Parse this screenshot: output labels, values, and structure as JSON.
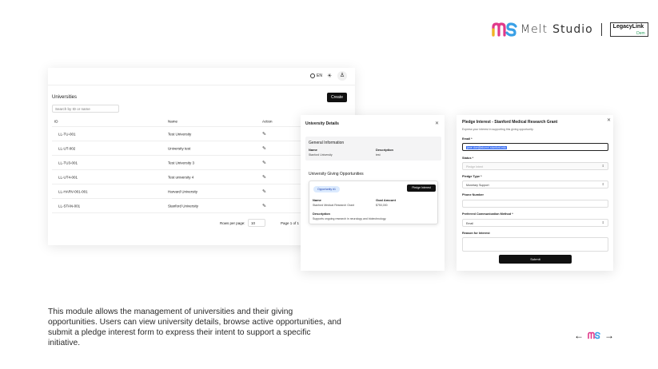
{
  "brand": {
    "melt": "Melt",
    "studio": "Studio",
    "partner_line1": "LegacyLink",
    "partner_line2": "Dem"
  },
  "panel_universities": {
    "lang": "EN",
    "title": "Universities",
    "create_label": "Create",
    "search_placeholder": "Search by ID or name",
    "columns": [
      "ID",
      "Name",
      "Action"
    ],
    "rows": [
      {
        "id": "LL-TU-001",
        "name": "Test University"
      },
      {
        "id": "LL-UT-002",
        "name": "University test"
      },
      {
        "id": "LL-TU3-001",
        "name": "Test University 3"
      },
      {
        "id": "LL-UT4-001",
        "name": "Test university 4"
      },
      {
        "id": "LL-HARV-001-001",
        "name": "Harvard University"
      },
      {
        "id": "LL-STAN-001",
        "name": "Stanford University"
      }
    ],
    "rows_per_page_label": "Rows per page:",
    "rows_per_page_value": "10",
    "page_of": "Page 1 of 1"
  },
  "panel_details": {
    "title": "University Details",
    "general_title": "General Information",
    "name_label": "Name",
    "name_value": "Stanford University",
    "desc_label": "Description",
    "desc_value": "test",
    "giving_title": "University Giving Opportunities",
    "opp_badge": "Opportunity #1",
    "pledge_button": "Pledge Interest",
    "opp_name_label": "Name",
    "opp_name_value": "Stanford Medical Research Grant",
    "goal_label": "Goal Amount",
    "goal_value": "$750,000",
    "opp_desc_label": "Description",
    "opp_desc_value": "Supports ongoing research in neurology and biotechnology."
  },
  "panel_pledge": {
    "title": "Pledge Interest - Stanford Medical Research Grant",
    "subtitle": "Express your interest in supporting this giving opportunity.",
    "email_label": "Email *",
    "email_value": "jane.doe@alumni.stanford.edu",
    "status_label": "Status *",
    "status_value": "Pledge Intent",
    "pledge_type_label": "Pledge Type *",
    "pledge_type_value": "Monetary Support",
    "phone_label": "Phone Number",
    "comm_label": "Preferred Communication Method *",
    "comm_value": "Email",
    "reason_label": "Reason for Interest",
    "submit_label": "Submit"
  },
  "description": "This module allows the management of universities and their giving opportunities. Users can view university details, browse active opportunities, and submit a pledge interest form to express their intent to support a specific initiative.",
  "nav": {
    "prev": "←",
    "next": "→"
  },
  "colors": {
    "accent_dark": "#111111",
    "badge_blue": "#dbeafe",
    "selection_blue": "#3b6ff2"
  }
}
